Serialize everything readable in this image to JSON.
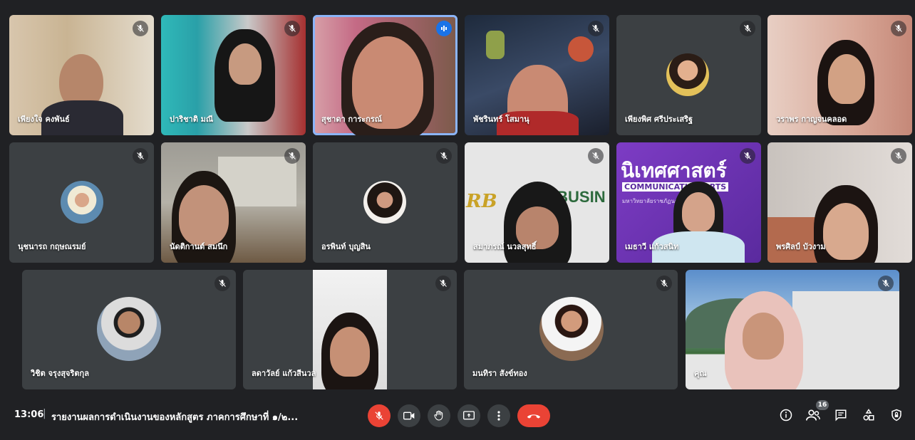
{
  "participants": [
    {
      "name": "เพียงใจ คงพันธ์",
      "muted": true
    },
    {
      "name": "ปาริชาติ มณี",
      "muted": true
    },
    {
      "name": "สุชาดา การะกรณ์",
      "speaking": true
    },
    {
      "name": "พัชรินทร์ โสมานุ",
      "muted": true
    },
    {
      "name": "เพียงพิศ ศรีประเสริฐ",
      "muted": true
    },
    {
      "name": "วราพร กาญจนคลอด",
      "muted": true
    },
    {
      "name": "นุชนารถ กฤษณรมย์",
      "muted": true
    },
    {
      "name": "นัดติกานต์ สมนึก",
      "muted": true
    },
    {
      "name": "อรพินท์ บุญสิน",
      "muted": true
    },
    {
      "name": "สมาภรณ์ นวลสุทธิ์",
      "muted": true
    },
    {
      "name": "เมธาวี แก้วสนิท",
      "muted": true
    },
    {
      "name": "พรศิลป์ บัวงาม",
      "muted": true
    },
    {
      "name": "วิชิต จรุงสุจริตกุล",
      "muted": true
    },
    {
      "name": "ลดาวัลย์ แก้วสีนวล",
      "muted": true
    },
    {
      "name": "มนทิรา สังข์ทอง",
      "muted": true
    },
    {
      "name": "คุณ",
      "muted": true
    }
  ],
  "backgrounds": {
    "communication_arts": "นิเทศศาสตร์",
    "communication_arts_en": "COMMUNICATION ARTS",
    "communication_arts_sub": "มหาวิทยาลัยราชภัฏนครศรีธรรมราช",
    "business_logo": "RB",
    "business_text": "L BUSIN"
  },
  "bottom_bar": {
    "time": "13:06",
    "separator": "|",
    "meeting_title": "รายงานผลการดำเนินงานของหลักสูตร ภาคการศึกษาที่ ๑/๒...",
    "participant_count": "16"
  },
  "controls": {
    "mic": "mic-off-icon",
    "camera": "camera-icon",
    "raise_hand": "raise-hand-icon",
    "present": "present-icon",
    "more": "more-options-icon",
    "end_call": "end-call-icon"
  },
  "colors": {
    "background": "#202124",
    "tile": "#3c4043",
    "accent_blue": "#1a73e8",
    "danger_red": "#ea4335"
  }
}
